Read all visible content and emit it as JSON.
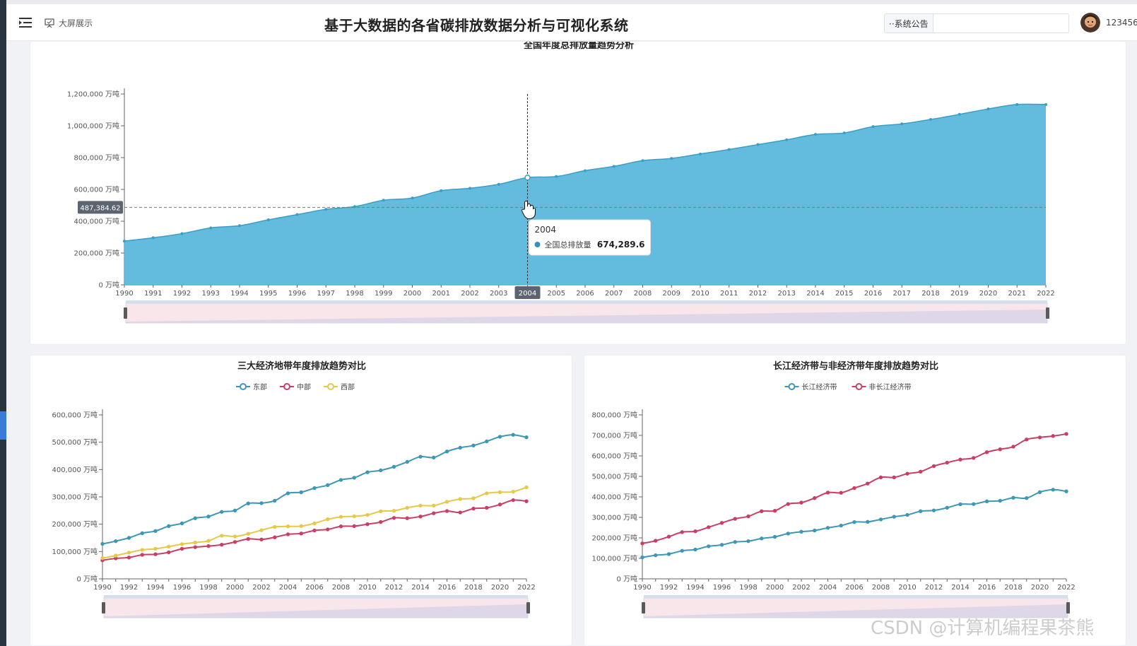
{
  "header": {
    "screen_link_label": "大屏展示",
    "app_title": "基于大数据的各省碳排放数据分析与可视化系统",
    "notice_label": "··系统公告",
    "notice_value": "",
    "username": "123456 ⌵"
  },
  "colors": {
    "area": "#5bb8dc",
    "east": "#3d97b5",
    "central": "#c93f64",
    "west": "#e8c848",
    "yangtze": "#3d97b5",
    "non_yangtze": "#c93f64"
  },
  "chart_data": [
    {
      "type": "area",
      "title": "全国年度总排放量趋势分析",
      "x": [
        "1990",
        "1991",
        "1992",
        "1993",
        "1994",
        "1995",
        "1996",
        "1997",
        "1998",
        "1999",
        "2000",
        "2001",
        "2002",
        "2003",
        "2004",
        "2005",
        "2006",
        "2007",
        "2008",
        "2009",
        "2010",
        "2011",
        "2012",
        "2013",
        "2014",
        "2015",
        "2016",
        "2017",
        "2018",
        "2019",
        "2020",
        "2021",
        "2022"
      ],
      "series": [
        {
          "name": "全国总排放量",
          "values": [
            275000,
            296000,
            322000,
            358000,
            372000,
            409000,
            442000,
            475000,
            492000,
            532000,
            546000,
            592000,
            607000,
            632000,
            674289.6,
            681000,
            718000,
            745000,
            781000,
            795000,
            823000,
            851000,
            882000,
            912000,
            946000,
            955000,
            995000,
            1012000,
            1040000,
            1072000,
            1106000,
            1134000,
            1134000
          ]
        }
      ],
      "ylim": [
        0,
        1200000
      ],
      "yticks": [
        0,
        200000,
        400000,
        600000,
        800000,
        1000000,
        1200000
      ],
      "ytick_labels": [
        "0 万吨",
        "200,000 万吨",
        "400,000 万吨",
        "600,000 万吨",
        "800,000 万吨",
        "1,000,000 万吨",
        "1,200,000 万吨"
      ],
      "crosshair": {
        "x_label": "2004",
        "y_label": "487,384.62",
        "y_value": 487384.62
      },
      "tooltip": {
        "title": "2004",
        "series": "全国总排放量",
        "value": "674,289.6"
      }
    },
    {
      "type": "line",
      "title": "三大经济地带年度排放趋势对比",
      "x": [
        "1990",
        "1991",
        "1992",
        "1993",
        "1994",
        "1995",
        "1996",
        "1997",
        "1998",
        "1999",
        "2000",
        "2001",
        "2002",
        "2003",
        "2004",
        "2005",
        "2006",
        "2007",
        "2008",
        "2009",
        "2010",
        "2011",
        "2012",
        "2013",
        "2014",
        "2015",
        "2016",
        "2017",
        "2018",
        "2019",
        "2020",
        "2021",
        "2022"
      ],
      "xticks_shown": [
        "1990",
        "1992",
        "1994",
        "1996",
        "1998",
        "2000",
        "2002",
        "2004",
        "2006",
        "2008",
        "2010",
        "2012",
        "2014",
        "2016",
        "2018",
        "2020",
        "2022"
      ],
      "series": [
        {
          "name": "东部",
          "values": [
            128000,
            138000,
            150000,
            167000,
            175000,
            193000,
            203000,
            222000,
            228000,
            245000,
            250000,
            276000,
            277000,
            286000,
            313000,
            317000,
            332000,
            343000,
            362000,
            370000,
            390000,
            397000,
            410000,
            428000,
            447000,
            444000,
            466000,
            480000,
            488000,
            503000,
            520000,
            527000,
            518000
          ]
        },
        {
          "name": "中部",
          "values": [
            68000,
            75000,
            78000,
            88000,
            90000,
            97000,
            110000,
            116000,
            120000,
            125000,
            135000,
            146000,
            144000,
            152000,
            163000,
            166000,
            177000,
            181000,
            192000,
            193000,
            200000,
            208000,
            223000,
            222000,
            228000,
            240000,
            248000,
            243000,
            257000,
            260000,
            272000,
            288000,
            284000
          ]
        },
        {
          "name": "西部",
          "values": [
            76000,
            85000,
            96000,
            106000,
            110000,
            118000,
            127000,
            133000,
            139000,
            158000,
            155000,
            165000,
            178000,
            190000,
            192000,
            193000,
            203000,
            218000,
            227000,
            229000,
            234000,
            247000,
            249000,
            260000,
            268000,
            268000,
            282000,
            292000,
            295000,
            313000,
            317000,
            319000,
            335000
          ]
        }
      ],
      "ylim": [
        0,
        600000
      ],
      "yticks": [
        0,
        100000,
        200000,
        300000,
        400000,
        500000,
        600000
      ],
      "ytick_labels": [
        "0 万吨",
        "100,000 万吨",
        "200,000 万吨",
        "300,000 万吨",
        "400,000 万吨",
        "500,000 万吨",
        "600,000 万吨"
      ],
      "legend": "top-center"
    },
    {
      "type": "line",
      "title": "长江经济带与非经济带年度排放趋势对比",
      "x": [
        "1990",
        "1991",
        "1992",
        "1993",
        "1994",
        "1995",
        "1996",
        "1997",
        "1998",
        "1999",
        "2000",
        "2001",
        "2002",
        "2003",
        "2004",
        "2005",
        "2006",
        "2007",
        "2008",
        "2009",
        "2010",
        "2011",
        "2012",
        "2013",
        "2014",
        "2015",
        "2016",
        "2017",
        "2018",
        "2019",
        "2020",
        "2021",
        "2022"
      ],
      "xticks_shown": [
        "1990",
        "1992",
        "1994",
        "1996",
        "1998",
        "2000",
        "2002",
        "2004",
        "2006",
        "2008",
        "2010",
        "2012",
        "2014",
        "2016",
        "2018",
        "2020",
        "2022"
      ],
      "series": [
        {
          "name": "长江经济带",
          "values": [
            105000,
            115000,
            121000,
            137000,
            143000,
            159000,
            166000,
            180000,
            184000,
            197000,
            205000,
            221000,
            230000,
            236000,
            249000,
            260000,
            277000,
            278000,
            290000,
            303000,
            312000,
            330000,
            334000,
            347000,
            364000,
            365000,
            378000,
            381000,
            396000,
            394000,
            423000,
            435000,
            427000
          ]
        },
        {
          "name": "非长江经济带",
          "values": [
            173000,
            186000,
            206000,
            228000,
            232000,
            252000,
            273000,
            293000,
            305000,
            330000,
            332000,
            365000,
            372000,
            394000,
            421000,
            420000,
            443000,
            465000,
            495000,
            495000,
            513000,
            523000,
            550000,
            567000,
            582000,
            590000,
            618000,
            632000,
            645000,
            680000,
            690000,
            697000,
            707000
          ]
        }
      ],
      "ylim": [
        0,
        800000
      ],
      "yticks": [
        0,
        100000,
        200000,
        300000,
        400000,
        500000,
        600000,
        700000,
        800000
      ],
      "ytick_labels": [
        "0 万吨",
        "100,000 万吨",
        "200,000 万吨",
        "300,000 万吨",
        "400,000 万吨",
        "500,000 万吨",
        "600,000 万吨",
        "700,000 万吨",
        "800,000 万吨"
      ],
      "legend": "top-center"
    }
  ],
  "watermark": "CSDN @计算机编程果茶熊"
}
